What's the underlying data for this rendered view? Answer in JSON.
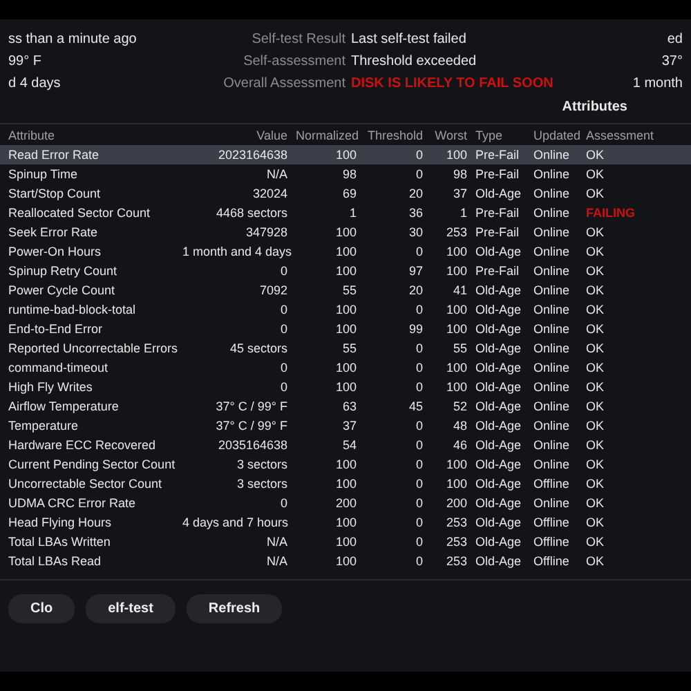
{
  "summary": [
    {
      "left": "ss than a minute ago",
      "label": "Self-test Result",
      "value": "Last self-test failed",
      "warning": false,
      "right": "ed"
    },
    {
      "left": "99° F",
      "label": "Self-assessment",
      "value": "Threshold exceeded",
      "warning": false,
      "right": "37°"
    },
    {
      "left": "d 4 days",
      "label": "Overall Assessment",
      "value": "DISK IS LIKELY TO FAIL SOON",
      "warning": true,
      "right": "1 month"
    }
  ],
  "attributes_heading": "Attributes",
  "table": {
    "columns": [
      "Attribute",
      "Value",
      "Normalized",
      "Threshold",
      "Worst",
      "Type",
      "Updated",
      "Assessment"
    ],
    "rows": [
      {
        "selected": true,
        "failing": false,
        "cells": [
          "Read Error Rate",
          "2023164638",
          "100",
          "0",
          "100",
          "Pre-Fail",
          "Online",
          "OK"
        ]
      },
      {
        "selected": false,
        "failing": false,
        "cells": [
          "Spinup Time",
          "N/A",
          "98",
          "0",
          "98",
          "Pre-Fail",
          "Online",
          "OK"
        ]
      },
      {
        "selected": false,
        "failing": false,
        "cells": [
          "Start/Stop Count",
          "32024",
          "69",
          "20",
          "37",
          "Old-Age",
          "Online",
          "OK"
        ]
      },
      {
        "selected": false,
        "failing": true,
        "cells": [
          "Reallocated Sector Count",
          "4468 sectors",
          "1",
          "36",
          "1",
          "Pre-Fail",
          "Online",
          "FAILING"
        ]
      },
      {
        "selected": false,
        "failing": false,
        "cells": [
          "Seek Error Rate",
          "347928",
          "100",
          "30",
          "253",
          "Pre-Fail",
          "Online",
          "OK"
        ]
      },
      {
        "selected": false,
        "failing": false,
        "cells": [
          "Power-On Hours",
          "1 month and 4 days",
          "100",
          "0",
          "100",
          "Old-Age",
          "Online",
          "OK"
        ]
      },
      {
        "selected": false,
        "failing": false,
        "cells": [
          "Spinup Retry Count",
          "0",
          "100",
          "97",
          "100",
          "Pre-Fail",
          "Online",
          "OK"
        ]
      },
      {
        "selected": false,
        "failing": false,
        "cells": [
          "Power Cycle Count",
          "7092",
          "55",
          "20",
          "41",
          "Old-Age",
          "Online",
          "OK"
        ]
      },
      {
        "selected": false,
        "failing": false,
        "cells": [
          "runtime-bad-block-total",
          "0",
          "100",
          "0",
          "100",
          "Old-Age",
          "Online",
          "OK"
        ]
      },
      {
        "selected": false,
        "failing": false,
        "cells": [
          "End-to-End Error",
          "0",
          "100",
          "99",
          "100",
          "Old-Age",
          "Online",
          "OK"
        ]
      },
      {
        "selected": false,
        "failing": false,
        "cells": [
          "Reported Uncorrectable Errors",
          "45 sectors",
          "55",
          "0",
          "55",
          "Old-Age",
          "Online",
          "OK"
        ]
      },
      {
        "selected": false,
        "failing": false,
        "cells": [
          "command-timeout",
          "0",
          "100",
          "0",
          "100",
          "Old-Age",
          "Online",
          "OK"
        ]
      },
      {
        "selected": false,
        "failing": false,
        "cells": [
          "High Fly Writes",
          "0",
          "100",
          "0",
          "100",
          "Old-Age",
          "Online",
          "OK"
        ]
      },
      {
        "selected": false,
        "failing": false,
        "cells": [
          "Airflow Temperature",
          "37° C / 99° F",
          "63",
          "45",
          "52",
          "Old-Age",
          "Online",
          "OK"
        ]
      },
      {
        "selected": false,
        "failing": false,
        "cells": [
          "Temperature",
          "37° C / 99° F",
          "37",
          "0",
          "48",
          "Old-Age",
          "Online",
          "OK"
        ]
      },
      {
        "selected": false,
        "failing": false,
        "cells": [
          "Hardware ECC Recovered",
          "2035164638",
          "54",
          "0",
          "46",
          "Old-Age",
          "Online",
          "OK"
        ]
      },
      {
        "selected": false,
        "failing": false,
        "cells": [
          "Current Pending Sector Count",
          "3 sectors",
          "100",
          "0",
          "100",
          "Old-Age",
          "Online",
          "OK"
        ]
      },
      {
        "selected": false,
        "failing": false,
        "cells": [
          "Uncorrectable Sector Count",
          "3 sectors",
          "100",
          "0",
          "100",
          "Old-Age",
          "Offline",
          "OK"
        ]
      },
      {
        "selected": false,
        "failing": false,
        "cells": [
          "UDMA CRC Error Rate",
          "0",
          "200",
          "0",
          "200",
          "Old-Age",
          "Online",
          "OK"
        ]
      },
      {
        "selected": false,
        "failing": false,
        "cells": [
          "Head Flying Hours",
          "4 days and 7 hours",
          "100",
          "0",
          "253",
          "Old-Age",
          "Offline",
          "OK"
        ]
      },
      {
        "selected": false,
        "failing": false,
        "cells": [
          "Total LBAs Written",
          "N/A",
          "100",
          "0",
          "253",
          "Old-Age",
          "Offline",
          "OK"
        ]
      },
      {
        "selected": false,
        "failing": false,
        "cells": [
          "Total LBAs Read",
          "N/A",
          "100",
          "0",
          "253",
          "Old-Age",
          "Offline",
          "OK"
        ]
      }
    ]
  },
  "buttons": [
    "Clo",
    "elf-test",
    "Refresh"
  ]
}
